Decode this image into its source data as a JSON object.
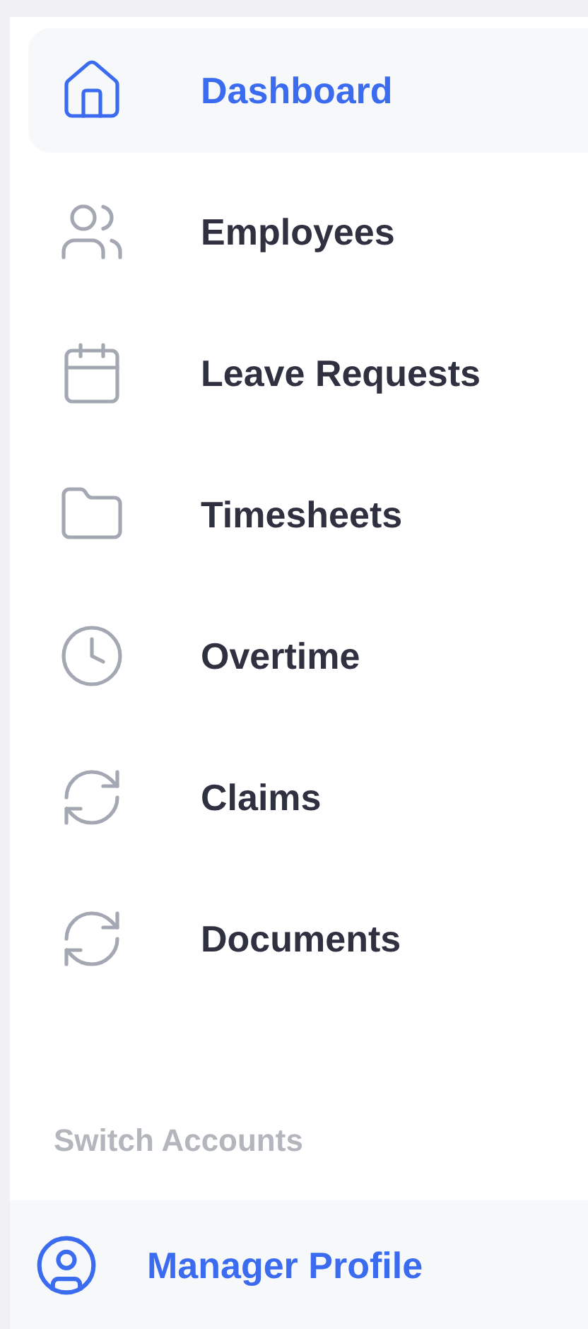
{
  "nav": {
    "items": [
      {
        "label": "Dashboard",
        "selected": true
      },
      {
        "label": "Employees",
        "selected": false
      },
      {
        "label": "Leave Requests",
        "selected": false
      },
      {
        "label": "Timesheets",
        "selected": false
      },
      {
        "label": "Overtime",
        "selected": false
      },
      {
        "label": "Claims",
        "selected": false
      },
      {
        "label": "Documents",
        "selected": false
      }
    ]
  },
  "switch_accounts": {
    "heading": "Switch Accounts",
    "items": [
      {
        "label": "Manager Profile",
        "selected": true
      }
    ]
  }
}
